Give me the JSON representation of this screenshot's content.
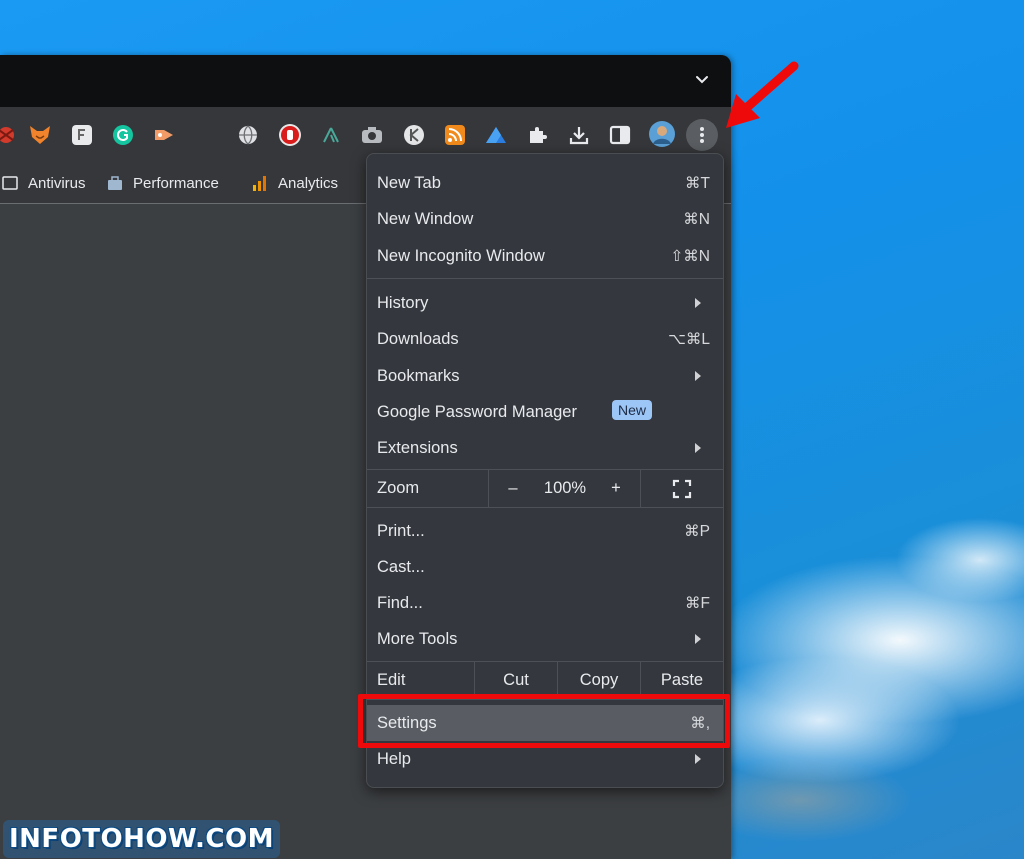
{
  "bookmarks": [
    {
      "label": "Antivirus",
      "icon": "folder-icon"
    },
    {
      "label": "Performance",
      "icon": "briefcase-icon"
    },
    {
      "label": "Analytics",
      "icon": "analytics-icon"
    }
  ],
  "extensions": [
    "spider-icon",
    "fox-icon",
    "f-icon",
    "grammarly-icon",
    "video-icon",
    "globe-icon",
    "hand-stop-icon",
    "fork-icon",
    "camera-icon",
    "k-icon",
    "rss-icon",
    "drive-icon",
    "puzzle-icon",
    "download-icon",
    "sidepanel-icon"
  ],
  "menu": {
    "new_tab": {
      "label": "New Tab",
      "shortcut": "⌘T"
    },
    "new_window": {
      "label": "New Window",
      "shortcut": "⌘N"
    },
    "new_incognito": {
      "label": "New Incognito Window",
      "shortcut": "⇧⌘N"
    },
    "history": {
      "label": "History"
    },
    "downloads": {
      "label": "Downloads",
      "shortcut": "⌥⌘L"
    },
    "bookmarks": {
      "label": "Bookmarks"
    },
    "password_manager": {
      "label": "Google Password Manager",
      "badge": "New"
    },
    "extensions": {
      "label": "Extensions"
    },
    "zoom": {
      "label": "Zoom",
      "minus": "–",
      "value": "100%",
      "plus": "+"
    },
    "print": {
      "label": "Print...",
      "shortcut": "⌘P"
    },
    "cast": {
      "label": "Cast..."
    },
    "find": {
      "label": "Find...",
      "shortcut": "⌘F"
    },
    "more_tools": {
      "label": "More Tools"
    },
    "edit": {
      "label": "Edit",
      "cut": "Cut",
      "copy": "Copy",
      "paste": "Paste"
    },
    "settings": {
      "label": "Settings",
      "shortcut": "⌘,"
    },
    "help": {
      "label": "Help"
    }
  },
  "watermark": "INFOTOHOW.COM",
  "colors": {
    "highlight": "#ee0a0a",
    "badge": "#9cc6f6"
  }
}
